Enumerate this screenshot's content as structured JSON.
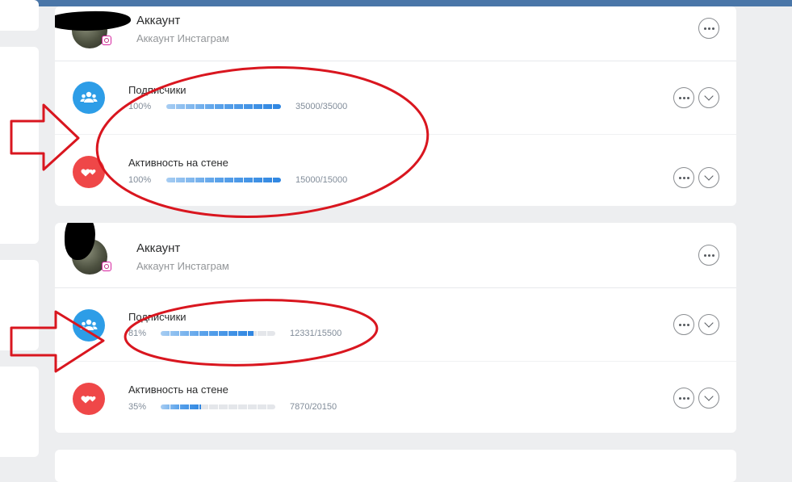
{
  "accounts": [
    {
      "title": "Аккаунт",
      "subtitle": "Аккаунт Инстаграм",
      "stats": [
        {
          "label": "Подписчики",
          "percent_text": "100%",
          "fill": 1.0,
          "count": "35000/35000",
          "icon": "users-icon"
        },
        {
          "label": "Активность на стене",
          "percent_text": "100%",
          "fill": 1.0,
          "count": "15000/15000",
          "icon": "hearts-icon"
        }
      ]
    },
    {
      "title": "Аккаунт",
      "subtitle": "Аккаунт Инстаграм",
      "stats": [
        {
          "label": "Подписчики",
          "percent_text": "81%",
          "fill": 0.81,
          "count": "12331/15500",
          "icon": "users-icon"
        },
        {
          "label": "Активность на стене",
          "percent_text": "35%",
          "fill": 0.35,
          "count": "7870/20150",
          "icon": "hearts-icon"
        }
      ]
    }
  ],
  "colors": {
    "topbar": "#4a76a8",
    "icon_blue": "#2d9de7",
    "icon_red": "#ef4748",
    "annotation_red": "#d9161f"
  }
}
